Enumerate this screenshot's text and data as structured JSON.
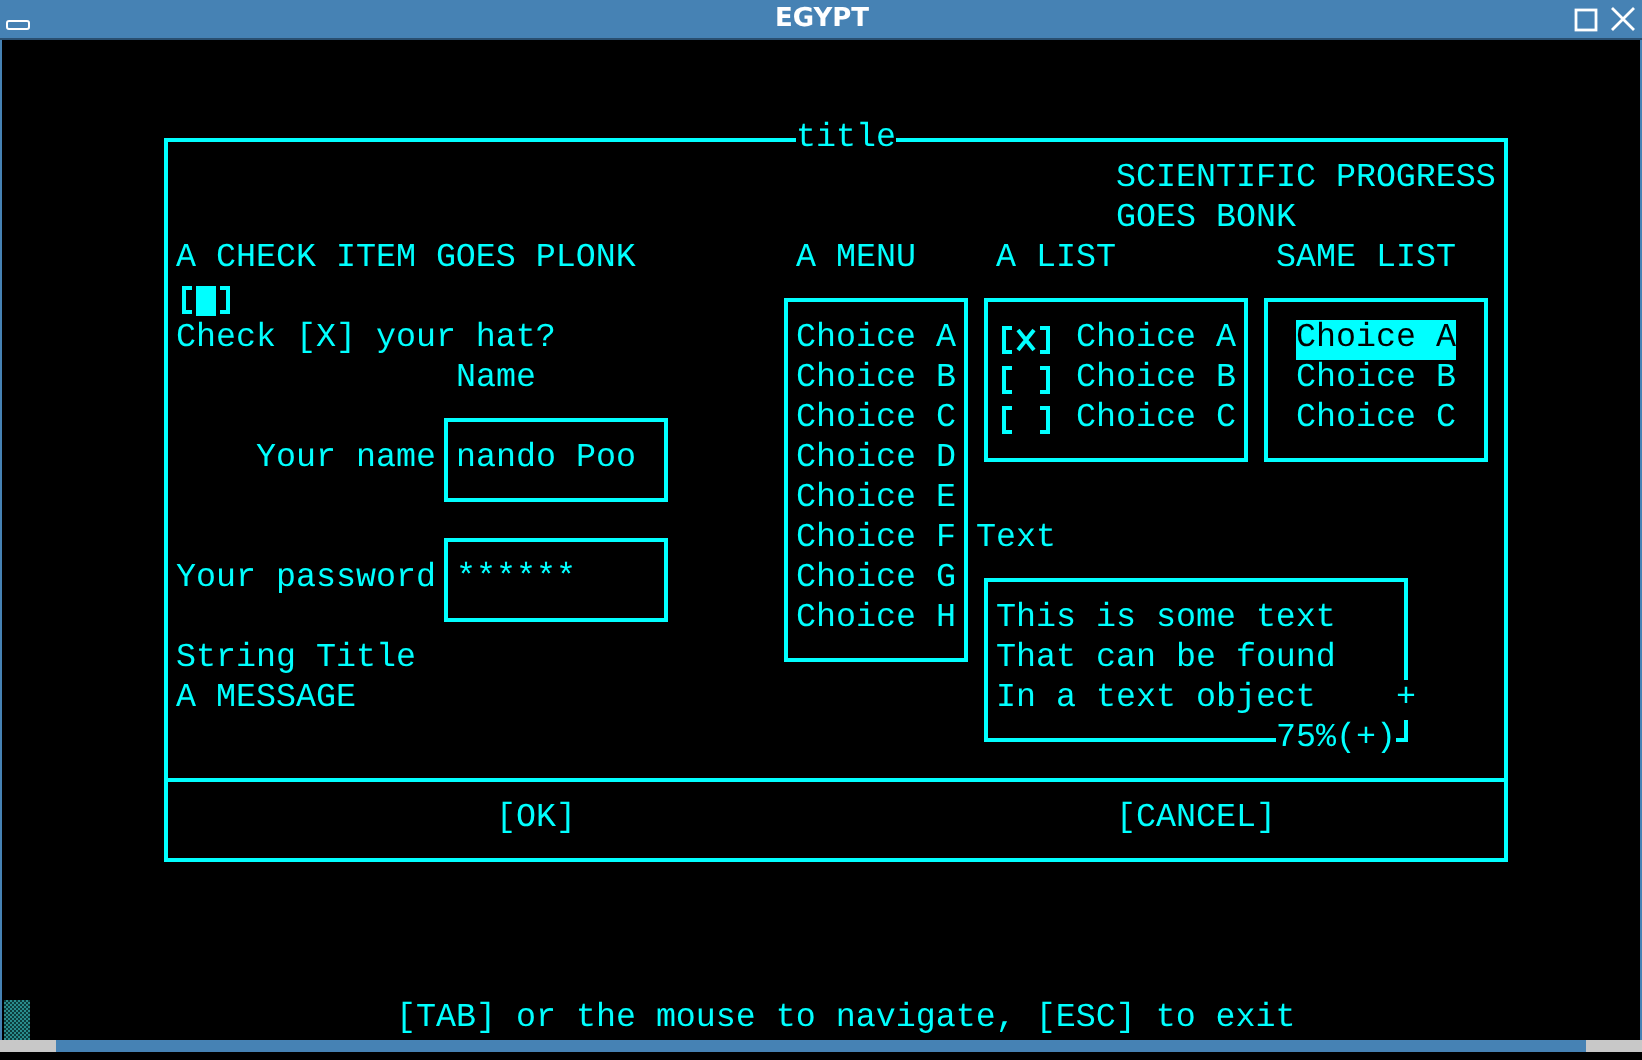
{
  "window": {
    "title": "EGYPT"
  },
  "dialog": {
    "title": "title",
    "banner_lines": [
      "SCIENTIFIC PROGRESS",
      "GOES BONK"
    ],
    "check_item": {
      "heading": "A CHECK ITEM GOES PLONK",
      "checked": false,
      "focused": true,
      "prompt": "Check [X] your hat?"
    },
    "name_field": {
      "heading": "Name",
      "label": "Your name",
      "value": "nando Poo"
    },
    "password_field": {
      "label": "Your password",
      "value": "******"
    },
    "string_title": "String Title",
    "message": "A MESSAGE",
    "menu": {
      "title": "A MENU",
      "items": [
        "Choice A",
        "Choice B",
        "Choice C",
        "Choice D",
        "Choice E",
        "Choice F",
        "Choice G",
        "Choice H"
      ]
    },
    "list": {
      "title": "A LIST",
      "items": [
        {
          "label": "Choice A",
          "checked": true
        },
        {
          "label": "Choice B",
          "checked": false
        },
        {
          "label": "Choice C",
          "checked": false
        }
      ]
    },
    "same_list": {
      "title": "SAME LIST",
      "items": [
        {
          "label": "Choice A",
          "selected": true
        },
        {
          "label": "Choice B",
          "selected": false
        },
        {
          "label": "Choice C",
          "selected": false
        }
      ]
    },
    "text_object": {
      "label": "Text",
      "lines": [
        "This is some text",
        "That can be found",
        "In a text object"
      ],
      "scroll_marker": "+",
      "scroll_status": "75%(+)"
    },
    "buttons": [
      "[OK]",
      "[CANCEL]"
    ]
  },
  "status_line": "[TAB] or the mouse to navigate, [ESC] to exit"
}
